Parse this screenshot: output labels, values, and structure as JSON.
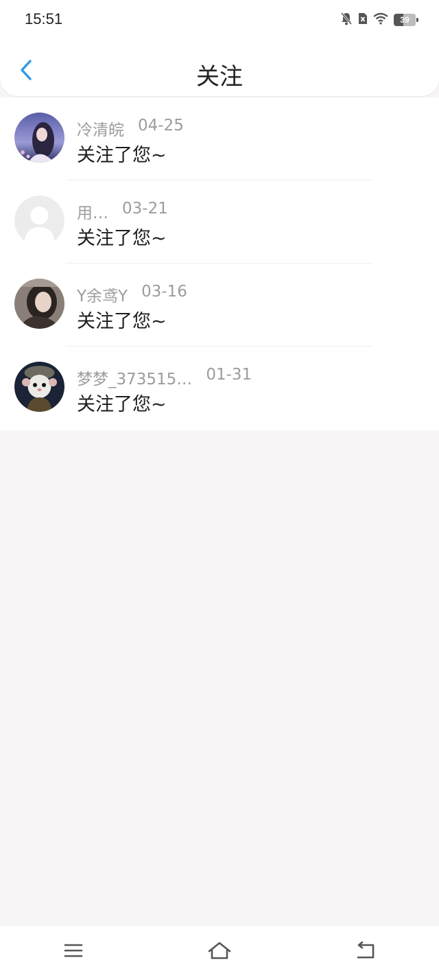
{
  "status_bar": {
    "time": "15:51",
    "battery": "39",
    "icons": [
      "bell-muted-icon",
      "sim-off-icon",
      "wifi-icon",
      "battery-icon"
    ]
  },
  "header": {
    "title": "关注",
    "back_icon": "chevron-left-icon",
    "accent": "#2f9be8"
  },
  "followers": [
    {
      "name": "冷清皖",
      "date": "04-25",
      "message": "关注了您~"
    },
    {
      "name": "用…",
      "date": "03-21",
      "message": "关注了您~"
    },
    {
      "name": "Y余鸢Y",
      "date": "03-16",
      "message": "关注了您~"
    },
    {
      "name": "梦梦_373515…",
      "date": "01-31",
      "message": "关注了您~"
    }
  ],
  "nav_bar": {
    "icons": [
      "menu-icon",
      "home-icon",
      "back-icon"
    ]
  }
}
